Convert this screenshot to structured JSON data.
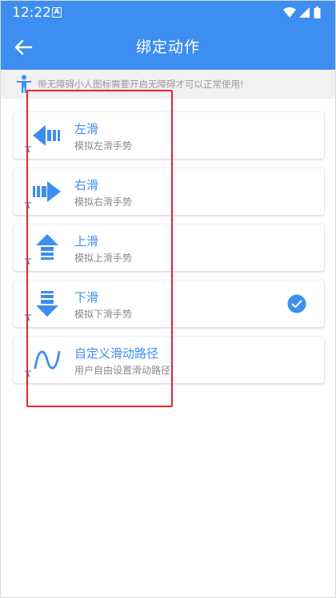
{
  "status_bar": {
    "time": "12:22",
    "notification": "A"
  },
  "app_bar": {
    "title": "绑定动作"
  },
  "notice": {
    "text": "带无障碍小人图标需要开启无障碍才可以正常使用!"
  },
  "items": [
    {
      "title": "左滑",
      "subtitle": "模拟左滑手势",
      "icon": "swipe-left-arrow-icon",
      "selected": false
    },
    {
      "title": "右滑",
      "subtitle": "模拟右滑手势",
      "icon": "swipe-right-arrow-icon",
      "selected": false
    },
    {
      "title": "上滑",
      "subtitle": "模拟上滑手势",
      "icon": "swipe-up-arrow-icon",
      "selected": false
    },
    {
      "title": "下滑",
      "subtitle": "模拟下滑手势",
      "icon": "swipe-down-arrow-icon",
      "selected": true
    },
    {
      "title": "自定义滑动路径",
      "subtitle": "用户自由设置滑动路径",
      "icon": "custom-path-wave-icon",
      "selected": false
    }
  ],
  "colors": {
    "primary": "#3d8ef0",
    "highlight": "#e8232b",
    "notice_bg": "#f1f1f3"
  }
}
